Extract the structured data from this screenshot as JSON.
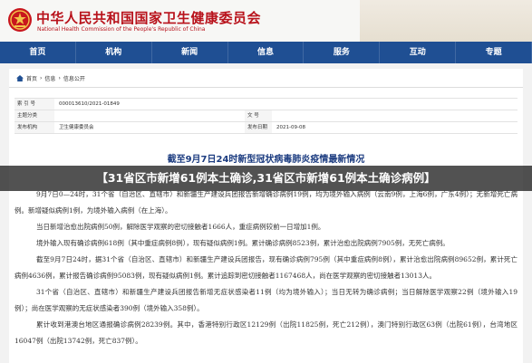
{
  "site": {
    "name_cn": "中华人民共和国国家卫生健康委员会",
    "name_en": "National Health Commission of the People's Republic of China"
  },
  "nav": [
    "首页",
    "机构",
    "新闻",
    "信息",
    "服务",
    "互动",
    "专题"
  ],
  "breadcrumb": [
    "首页",
    "信息",
    "信息公开"
  ],
  "meta": {
    "index_label": "索 引 号",
    "index_value": "000013610/2021-01849",
    "category_label": "主题分类",
    "category_value": "",
    "issuer_label": "发布机构",
    "issuer_value": "卫生健康委员会",
    "docno_label": "文 号",
    "docno_value": "",
    "date_label": "发布日期",
    "date_value": "2021-09-08"
  },
  "article": {
    "title": "截至9月7日24时新型冠状病毒肺炎疫情最新情况",
    "paragraphs": [
      "9月7日0—24时，31个省（自治区、直辖市）和新疆生产建设兵团报告新增确诊病例19例，均为境外输入病例（云南9例，上海6例，广东4例）；无新增死亡病例。新增疑似病例1例，为境外输入病例（在上海）。",
      "当日新增治愈出院病例50例，解除医学观察的密切接触者1666人，重症病例较前一日增加1例。",
      "境外输入现有确诊病例618例（其中重症病例8例），现有疑似病例1例。累计确诊病例8523例，累计治愈出院病例7905例，无死亡病例。",
      "截至9月7日24时，据31个省（自治区、直辖市）和新疆生产建设兵团报告，现有确诊病例795例（其中重症病例8例），累计治愈出院病例89652例，累计死亡病例4636例，累计报告确诊病例95083例，现有疑似病例1例。累计追踪到密切接触者1167468人，尚在医学观察的密切接触者13013人。",
      "31个省（自治区、直辖市）和新疆生产建设兵团报告新增无症状感染者11例（均为境外输入）；当日无转为确诊病例；当日解除医学观察22例（境外输入19例）；尚在医学观察的无症状感染者390例（境外输入358例）。",
      "累计收到港澳台地区通报确诊病例28239例。其中，香港特别行政区12129例（出院11825例，死亡212例），澳门特别行政区63例（出院61例），台湾地区16047例（出院13742例，死亡837例）。"
    ]
  },
  "overlay": {
    "text": "【31省区市新增61例本土确诊,31省区市新增61例本土确诊病例】"
  },
  "colors": {
    "brand_red": "#b8121b",
    "nav_blue": "#1f4f93",
    "title_blue": "#1c3c80"
  }
}
